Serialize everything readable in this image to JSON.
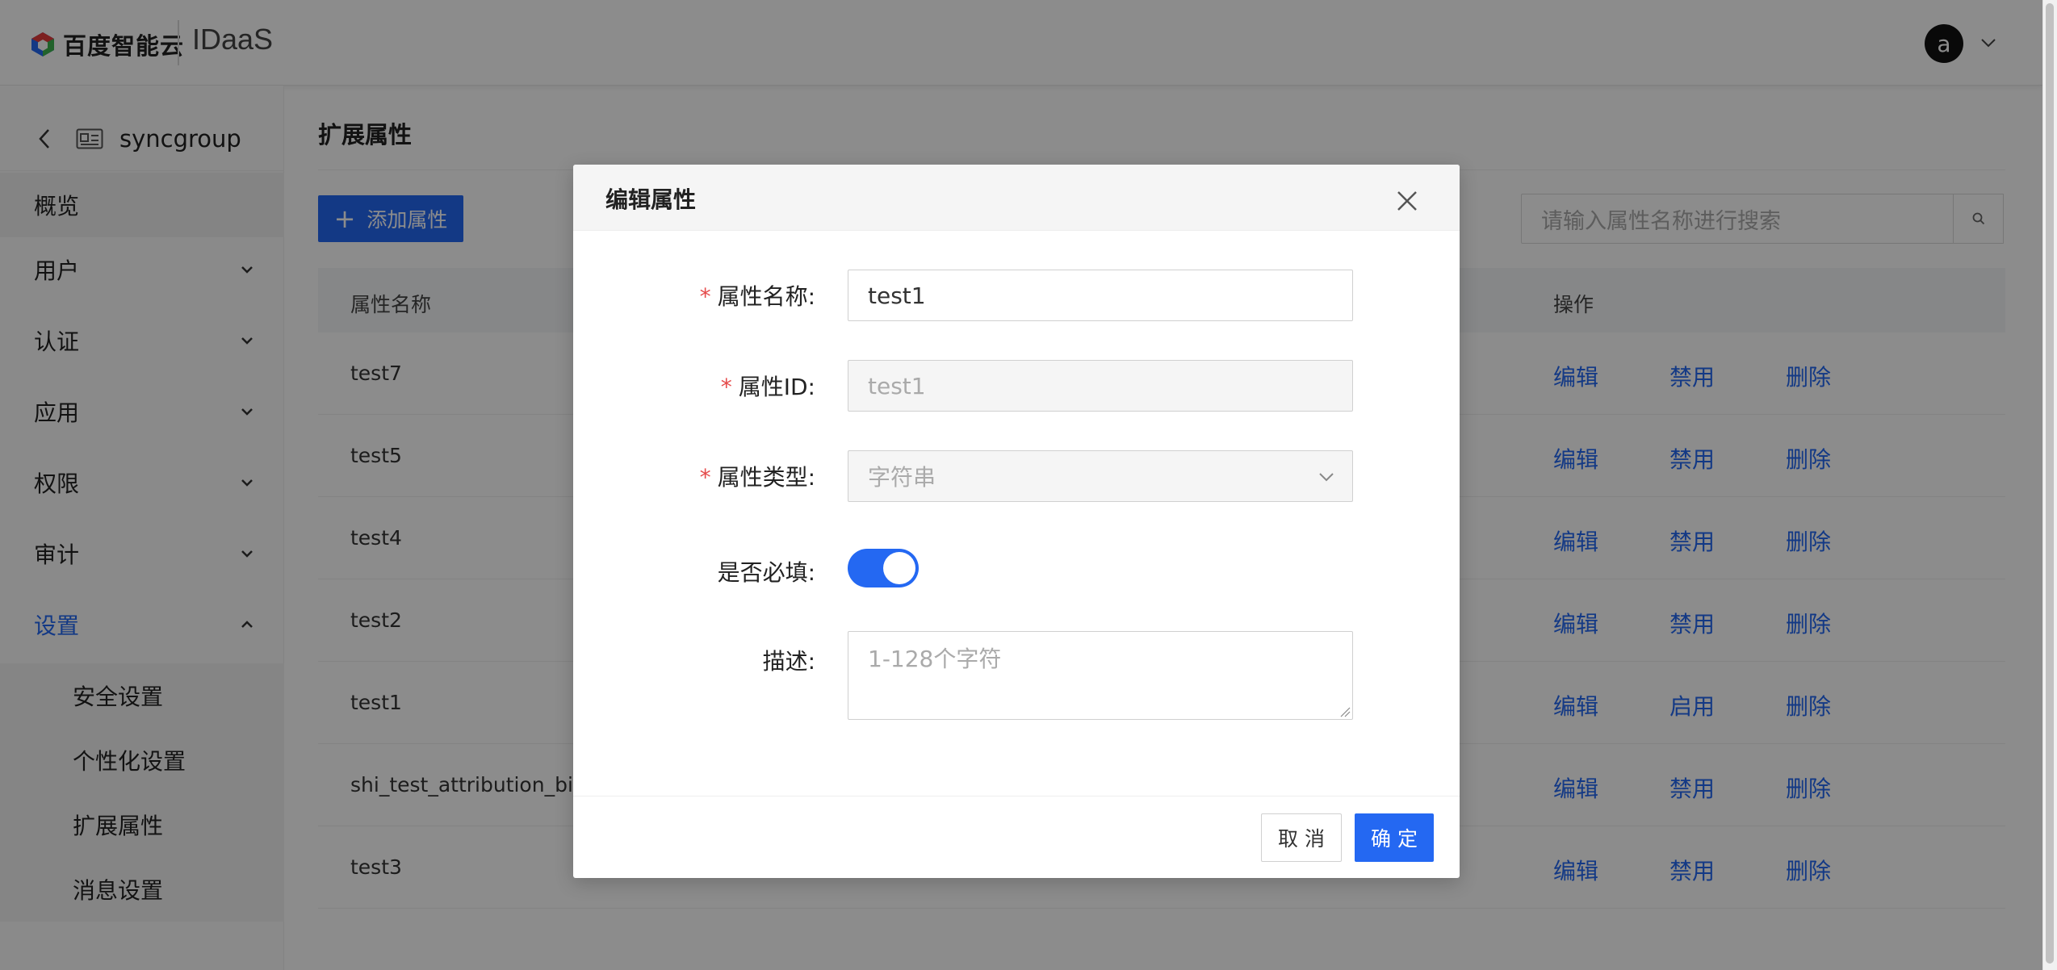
{
  "header": {
    "brand": "百度智能云",
    "product": "IDaaS",
    "avatar_letter": "a"
  },
  "sidebar": {
    "app_name": "syncgroup",
    "items": [
      {
        "label": "概览"
      },
      {
        "label": "用户"
      },
      {
        "label": "认证"
      },
      {
        "label": "应用"
      },
      {
        "label": "权限"
      },
      {
        "label": "审计"
      },
      {
        "label": "设置"
      }
    ],
    "sub_items": [
      {
        "label": "安全设置"
      },
      {
        "label": "个性化设置"
      },
      {
        "label": "扩展属性"
      },
      {
        "label": "消息设置"
      }
    ]
  },
  "main": {
    "title": "扩展属性",
    "add_button": "添加属性",
    "search_placeholder": "请输入属性名称进行搜索",
    "columns": {
      "name": "属性名称",
      "ops": "操作"
    },
    "rows": [
      {
        "name": "test7",
        "edit": "编辑",
        "toggle": "禁用",
        "delete": "删除"
      },
      {
        "name": "test5",
        "edit": "编辑",
        "toggle": "禁用",
        "delete": "删除"
      },
      {
        "name": "test4",
        "edit": "编辑",
        "toggle": "禁用",
        "delete": "删除"
      },
      {
        "name": "test2",
        "edit": "编辑",
        "toggle": "禁用",
        "delete": "删除"
      },
      {
        "name": "test1",
        "edit": "编辑",
        "toggle": "启用",
        "delete": "删除"
      },
      {
        "name": "shi_test_attribution_birth",
        "edit": "编辑",
        "toggle": "禁用",
        "delete": "删除"
      },
      {
        "name": "test3",
        "edit": "编辑",
        "toggle": "禁用",
        "delete": "删除"
      }
    ]
  },
  "modal": {
    "title": "编辑属性",
    "fields": {
      "name_label": "属性名称:",
      "name_value": "test1",
      "id_label": "属性ID:",
      "id_value": "test1",
      "type_label": "属性类型:",
      "type_value": "字符串",
      "required_label": "是否必填:",
      "required_on": true,
      "desc_label": "描述:",
      "desc_placeholder": "1-128个字符"
    },
    "cancel": "取 消",
    "ok": "确 定"
  },
  "colors": {
    "primary": "#2468f2",
    "required_star": "#e54b4b",
    "mask": "rgba(0,0,0,0.45)"
  }
}
